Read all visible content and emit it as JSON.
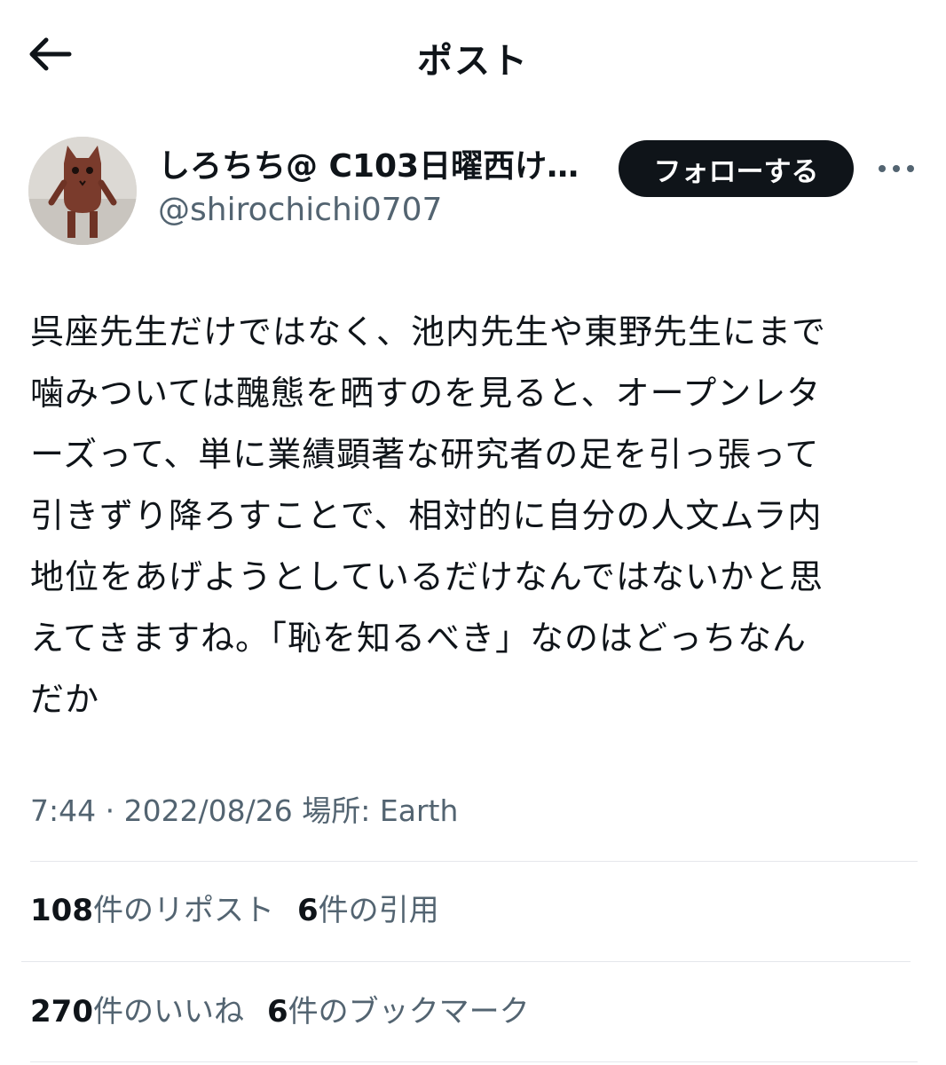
{
  "header": {
    "title": "ポスト",
    "back_icon": "arrow-left-icon"
  },
  "author": {
    "display_name": "しろちち@ C103日曜西け…",
    "handle": "@shirochichi0707",
    "follow_label": "フォローする",
    "more_icon": "more-horizontal-icon"
  },
  "post": {
    "text": "呉座先生だけではなく、池内先生や東野先生にまで\n噛みついては醜態を晒すのを見ると、オープンレタ\nーズって、単に業績顕著な研究者の足を引っ張って\n引きずり降ろすことで、相対的に自分の人文ムラ内\n地位をあげようとしているだけなんではないかと思\nえてきますね。「恥を知るべき」なのはどっちなん\nだか",
    "meta": "7:44 · 2022/08/26 場所: Earth"
  },
  "stats": {
    "reposts": {
      "count": "108",
      "label": "件のリポスト"
    },
    "quotes": {
      "count": "6",
      "label": "件の引用"
    },
    "likes": {
      "count": "270",
      "label": "件のいいね"
    },
    "bookmarks": {
      "count": "6",
      "label": "件のブックマーク"
    }
  },
  "colors": {
    "text": "#0f1419",
    "secondary": "#536471",
    "button_bg": "#0f1419",
    "divider": "#e5e7eb"
  }
}
